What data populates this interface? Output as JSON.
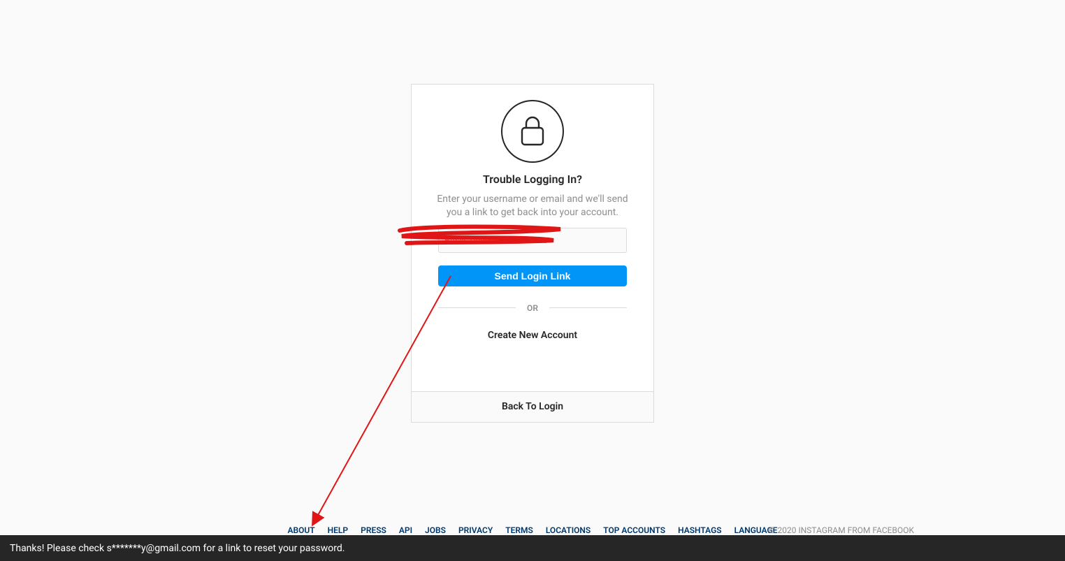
{
  "card": {
    "title": "Trouble Logging In?",
    "description": "Enter your username or email and we'll send you a link to get back into your account.",
    "input_placeholder": "Email, Phone, or Username",
    "send_button": "Send Login Link",
    "or_label": "OR",
    "create_account": "Create New Account",
    "back_to_login": "Back To Login"
  },
  "footer": {
    "links": [
      "ABOUT",
      "HELP",
      "PRESS",
      "API",
      "JOBS",
      "PRIVACY",
      "TERMS",
      "LOCATIONS",
      "TOP ACCOUNTS",
      "HASHTAGS",
      "LANGUAGE"
    ],
    "copyright": "© 2020 INSTAGRAM FROM FACEBOOK"
  },
  "toast": {
    "message": "Thanks! Please check s*******y@gmail.com for a link to reset your password."
  }
}
